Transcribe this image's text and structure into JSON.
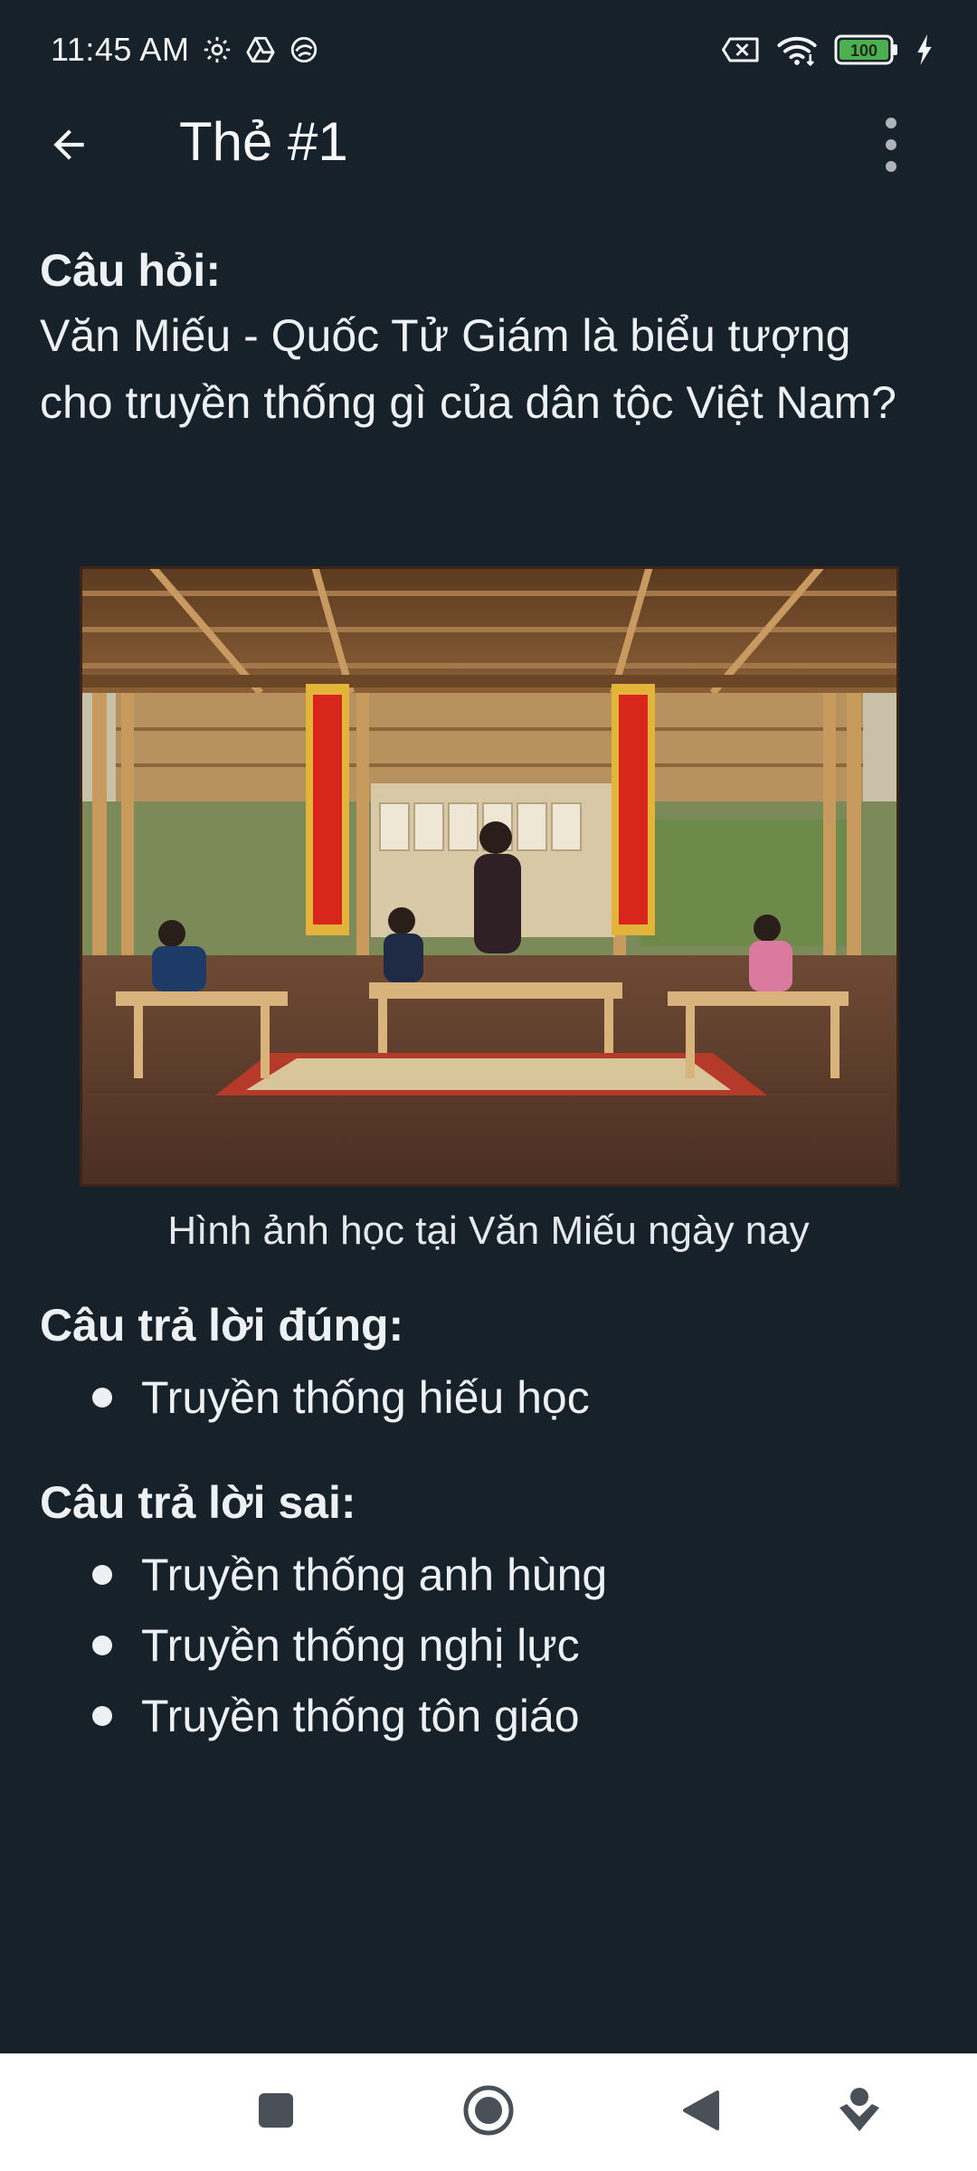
{
  "status_bar": {
    "time": "11:45 AM",
    "icons_left": [
      "settings-icon",
      "drive-icon",
      "sync-icon"
    ],
    "icons_right": [
      "sim-off-icon",
      "wifi-icon",
      "battery-icon",
      "charging-icon"
    ],
    "battery": "100",
    "battery_color": "#4caf50"
  },
  "app_bar": {
    "title": "Thẻ #1",
    "back_icon": "arrow-back-icon",
    "menu_icon": "more-vert-icon"
  },
  "question": {
    "heading": "Câu hỏi:",
    "text": "Văn Miếu - Quốc Tử Giám là biểu tượng cho truyền thống gì của dân tộc Việt Nam?"
  },
  "image": {
    "caption": "Hình ảnh học tại Văn Miếu ngày nay"
  },
  "correct_answers": {
    "heading": "Câu trả lời đúng:",
    "items": [
      "Truyền thống hiếu học"
    ]
  },
  "wrong_answers": {
    "heading": "Câu trả lời sai:",
    "items": [
      "Truyền thống anh hùng",
      "Truyền thống nghị lực",
      "Truyền thống tôn giáo"
    ]
  },
  "nav_bar": {
    "icons": [
      "recents-icon",
      "home-icon",
      "back-icon",
      "assistant-icon"
    ]
  },
  "colors": {
    "background": "#17212a",
    "text": "#eef1f4",
    "nav_background": "#ffffff",
    "nav_icon": "#4a5058"
  }
}
